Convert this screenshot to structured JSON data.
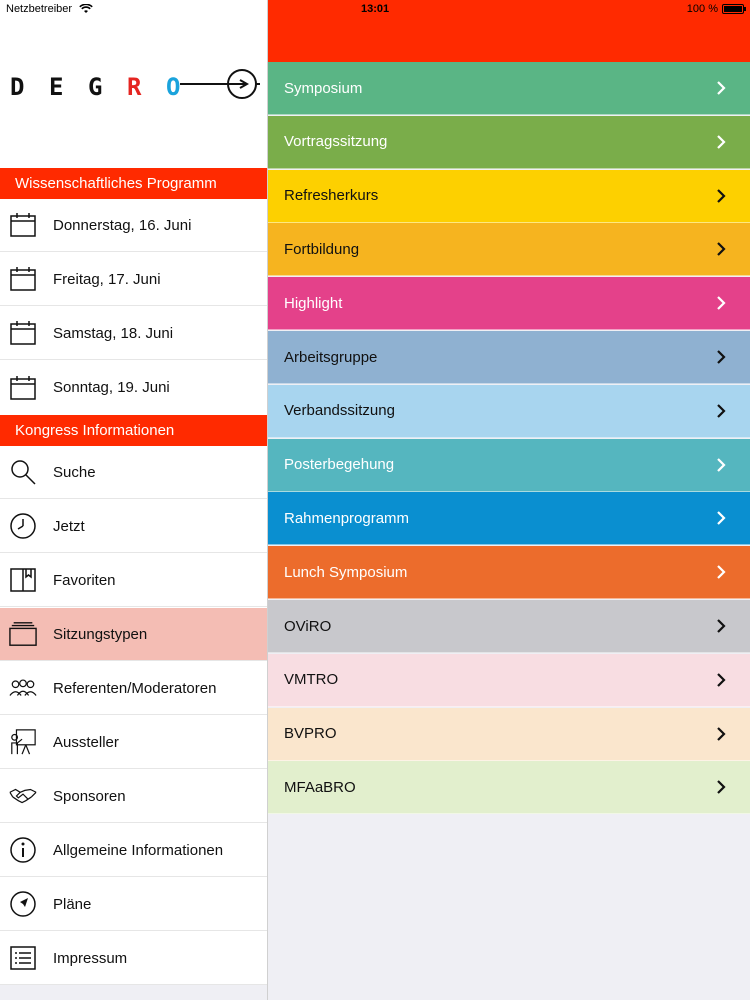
{
  "status_bar": {
    "carrier": "Netzbetreiber",
    "time": "13:01",
    "battery": "100 %"
  },
  "logo": {
    "letters": [
      "D",
      "E",
      "G",
      "R",
      "O"
    ],
    "colors": {
      "default": "#111111",
      "R": "#e52521",
      "O": "#1aa3dc"
    }
  },
  "sidebar": {
    "section1_title": "Wissenschaftliches Programm",
    "days": [
      {
        "label": "Donnerstag, 16. Juni",
        "icon": "calendar-icon"
      },
      {
        "label": "Freitag, 17. Juni",
        "icon": "calendar-icon"
      },
      {
        "label": "Samstag, 18. Juni",
        "icon": "calendar-icon"
      },
      {
        "label": "Sonntag, 19. Juni",
        "icon": "calendar-icon"
      }
    ],
    "section2_title": "Kongress Informationen",
    "items": [
      {
        "label": "Suche",
        "icon": "search-icon"
      },
      {
        "label": "Jetzt",
        "icon": "clock-icon"
      },
      {
        "label": "Favoriten",
        "icon": "bookmark-icon"
      },
      {
        "label": "Sitzungstypen",
        "icon": "layers-icon",
        "active": true
      },
      {
        "label": "Referenten/Moderatoren",
        "icon": "people-icon"
      },
      {
        "label": "Aussteller",
        "icon": "presenter-icon"
      },
      {
        "label": "Sponsoren",
        "icon": "handshake-icon"
      },
      {
        "label": "Allgemeine Informationen",
        "icon": "info-icon"
      },
      {
        "label": "Pläne",
        "icon": "navigation-icon"
      },
      {
        "label": "Impressum",
        "icon": "list-icon"
      }
    ]
  },
  "header": {
    "color": "#ff2a00"
  },
  "session_types": [
    {
      "label": "Symposium",
      "color": "#5ab585",
      "text": "#ffffff"
    },
    {
      "label": "Vortragssitzung",
      "color": "#7aad4a",
      "text": "#ffffff"
    },
    {
      "label": "Refresherkurs",
      "color": "#fdd000",
      "text": "#111111"
    },
    {
      "label": "Fortbildung",
      "color": "#f6b41f",
      "text": "#111111"
    },
    {
      "label": "Highlight",
      "color": "#e4418a",
      "text": "#ffffff"
    },
    {
      "label": "Arbeitsgruppe",
      "color": "#8fb1d1",
      "text": "#111111"
    },
    {
      "label": "Verbandssitzung",
      "color": "#a8d5ef",
      "text": "#111111"
    },
    {
      "label": "Posterbegehung",
      "color": "#55b6bf",
      "text": "#ffffff"
    },
    {
      "label": "Rahmenprogramm",
      "color": "#0a8fd0",
      "text": "#ffffff"
    },
    {
      "label": "Lunch Symposium",
      "color": "#ec6c2c",
      "text": "#ffffff"
    },
    {
      "label": "OViRO",
      "color": "#c8c8cc",
      "text": "#111111"
    },
    {
      "label": "VMTRO",
      "color": "#f8dde2",
      "text": "#111111"
    },
    {
      "label": "BVPRO",
      "color": "#fae6cd",
      "text": "#111111"
    },
    {
      "label": "MFAaBRO",
      "color": "#e2efcd",
      "text": "#111111"
    }
  ]
}
